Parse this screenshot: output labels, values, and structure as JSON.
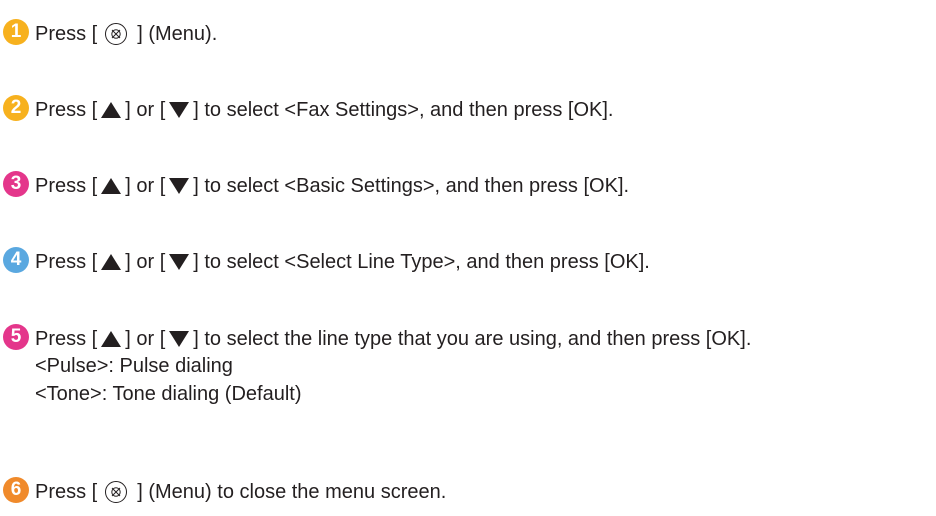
{
  "colors": {
    "step_badge_yellow": "#f7b11e",
    "step_badge_blue": "#5aa8e0",
    "step_badge_pink": "#e4368b",
    "step_badge_orange": "#f08a2b",
    "step_badge_green": "#6ab945",
    "text": "#231f20"
  },
  "steps": [
    {
      "number": "1",
      "badge_color": "#f7b11e",
      "text_before": "Press [",
      "text_after": "] (Menu).",
      "icon": "menu-icon"
    },
    {
      "number": "2",
      "badge_color": "#f7b11e",
      "text_before": "Press [",
      "text_mid": "] or [",
      "text_after": "] to select <Fax Settings>, and then press [OK].",
      "icons": [
        "up-triangle-icon",
        "down-triangle-icon"
      ]
    },
    {
      "number": "3",
      "badge_color": "#e4368b",
      "text_before": "Press [",
      "text_mid": "] or [",
      "text_after": "] to select <Basic Settings>, and then press [OK].",
      "icons": [
        "up-triangle-icon",
        "down-triangle-icon"
      ]
    },
    {
      "number": "4",
      "badge_color": "#5aa8e0",
      "text_before": "Press [",
      "text_mid": "] or [",
      "text_after": "] to select <Select Line Type>, and then press [OK].",
      "icons": [
        "up-triangle-icon",
        "down-triangle-icon"
      ]
    },
    {
      "number": "5",
      "badge_color": "#e4368b",
      "text_before": "Press [",
      "text_mid": "] or [",
      "text_after": "] to select the line type that you are using, and then press [OK].",
      "icons": [
        "up-triangle-icon",
        "down-triangle-icon"
      ],
      "sub_lines": [
        "<Pulse>: Pulse dialing",
        "<Tone>: Tone dialing (Default)"
      ]
    },
    {
      "number": "6",
      "badge_color": "#f08a2b",
      "text_before": "Press [",
      "text_after": "] (Menu) to close the menu screen.",
      "icon": "menu-icon"
    }
  ]
}
